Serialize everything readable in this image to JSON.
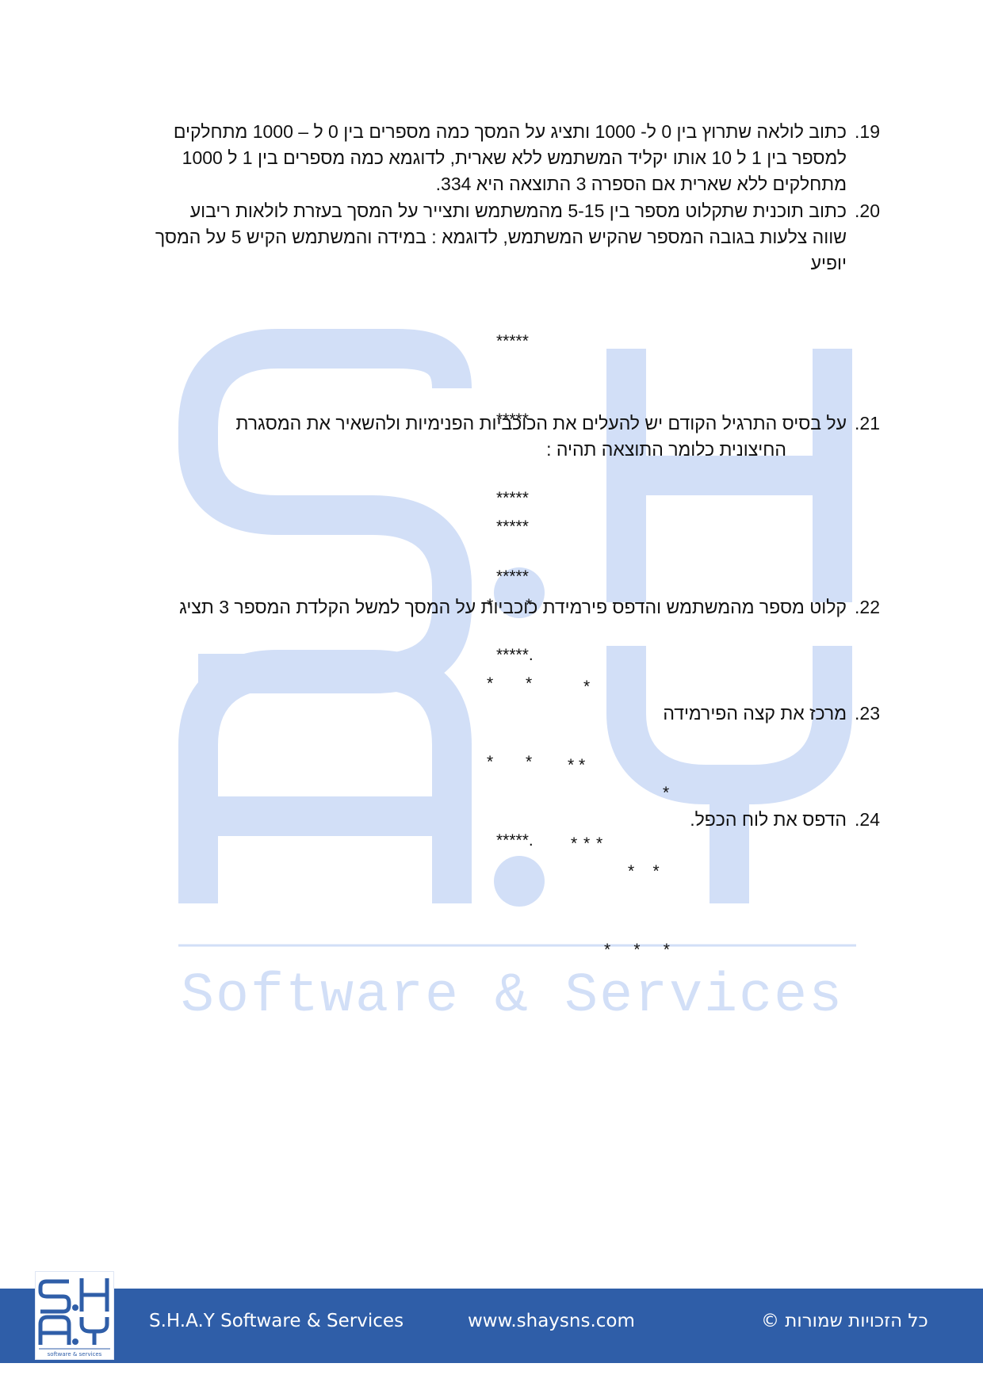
{
  "watermark": {
    "letters": [
      "S",
      ".",
      "H",
      "A",
      ".",
      "Y"
    ],
    "tagline": "Software & Services",
    "color": "#d2dff7"
  },
  "exercises": [
    {
      "number": "19.",
      "lines": [
        "כתוב לולאה שתרוץ בין 0 ל- 1000 ותציג על המסך כמה מספרים בין 0 ל – 1000 מתחלקים",
        "למספר בין 1  ל 10 אותו יקליד המשתמש ללא שארית, לדוגמא כמה מספרים בין 1 ל 1000",
        "מתחלקים ללא שארית אם הספרה 3 התוצאה היא 334."
      ]
    },
    {
      "number": "20.",
      "lines": [
        "כתוב תוכנית שתקלוט מספר בין 5-15 מהמשתמש ותצייר על המסך בעזרת לולאות ריבוע",
        "שווה צלעות בגובה המספר שהקיש המשתמש, לדוגמא : במידה והמשתמש הקיש 5 על המסך",
        "יופיע"
      ],
      "pattern": [
        "*****",
        "*****",
        "*****",
        "*****",
        "*****."
      ]
    },
    {
      "number": "21.",
      "lines": [
        "על בסיס התרגיל הקודם יש להעלים את הכוכביות הפנימיות ולהשאיר את המסגרת",
        "החיצונית כלומר התוצאה תהיה :"
      ],
      "pattern": [
        "*****",
        "*       *",
        "*       *",
        "*       *",
        "*****."
      ]
    },
    {
      "number": "22.",
      "lines": [
        "קלוט מספר מהמשתמש והדפס פירמידת כוכביות על המסך למשל הקלדת המספר 3 תציג"
      ],
      "pattern": [
        "*",
        "* *",
        "* * *"
      ]
    },
    {
      "number": "23.",
      "lines": [
        "מרכז את קצה הפירמידה"
      ],
      "pattern": [
        "*",
        "*    *",
        "*     *     *"
      ]
    },
    {
      "number": "24.",
      "lines": [
        "הדפס את לוח הכפל."
      ]
    }
  ],
  "footer": {
    "company": "S.H.A.Y Software & Services",
    "website": "www.shaysns.com",
    "rights": "כל הזכויות שמורות ©",
    "logo_text": "software & services",
    "bg_color": "#2f5ea8"
  }
}
